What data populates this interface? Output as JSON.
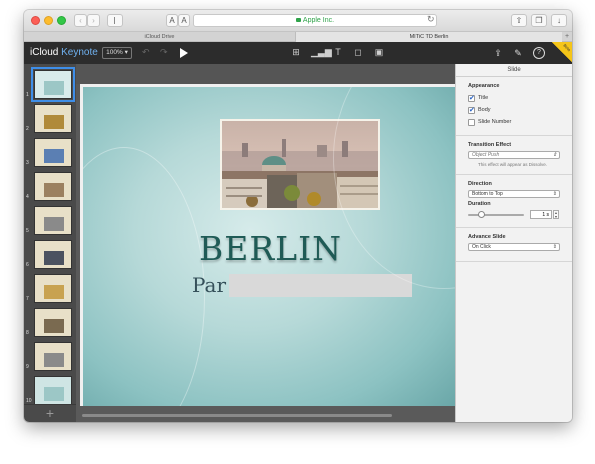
{
  "browser": {
    "text_size_small": "A",
    "text_size_large": "A",
    "address": "Apple Inc.",
    "tabs": [
      {
        "label": "iCloud Drive"
      },
      {
        "label": "MITiC TD Berlin"
      }
    ]
  },
  "app": {
    "brand": "iCloud",
    "name": "Keynote",
    "zoom": "100%",
    "beta_label": "Beta"
  },
  "navigator": {
    "slides": [
      {
        "number": "1",
        "selected": true
      },
      {
        "number": "2"
      },
      {
        "number": "3"
      },
      {
        "number": "4"
      },
      {
        "number": "5"
      },
      {
        "number": "6"
      },
      {
        "number": "7"
      },
      {
        "number": "8"
      },
      {
        "number": "9"
      },
      {
        "number": "10"
      }
    ],
    "add_label": "+"
  },
  "slide": {
    "title": "BERLIN",
    "body": "Par"
  },
  "inspector": {
    "header": "Slide",
    "appearance": {
      "label": "Appearance",
      "title": "Title",
      "body": "Body",
      "slide_number": "Slide Number"
    },
    "transition": {
      "label": "Transition Effect",
      "value": "Object Push",
      "note": "This effect will appear as Dissolve."
    },
    "direction": {
      "label": "Direction",
      "value": "Bottom to Top"
    },
    "duration": {
      "label": "Duration",
      "value": "1 s"
    },
    "advance": {
      "label": "Advance Slide",
      "value": "On Click"
    }
  }
}
